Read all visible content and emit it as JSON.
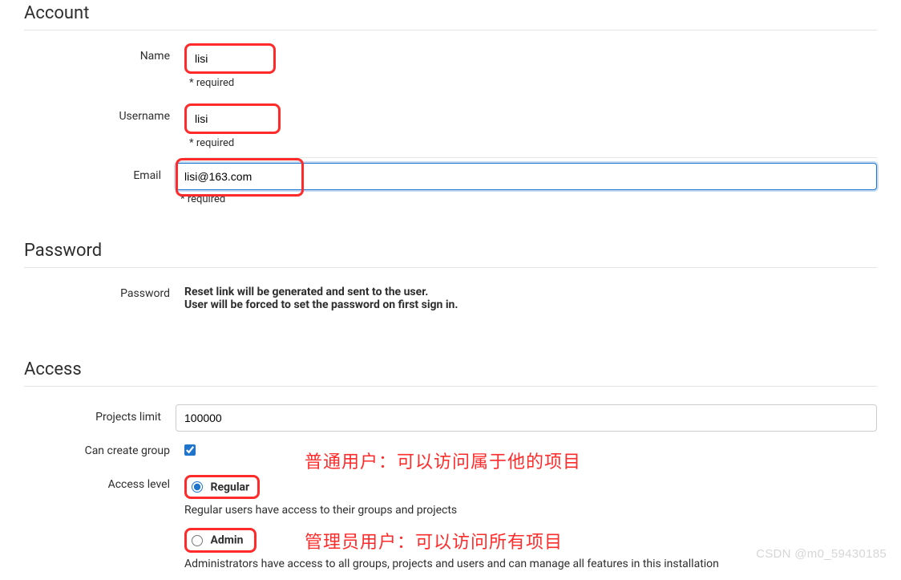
{
  "account": {
    "title": "Account",
    "name_label": "Name",
    "name_value": "lisi",
    "name_help": "* required",
    "username_label": "Username",
    "username_value": "lisi",
    "username_help": "* required",
    "email_label": "Email",
    "email_value": "lisi@163.com",
    "email_help": "* required"
  },
  "password": {
    "title": "Password",
    "label": "Password",
    "line1": "Reset link will be generated and sent to the user.",
    "line2": "User will be forced to set the password on first sign in."
  },
  "access": {
    "title": "Access",
    "projects_limit_label": "Projects limit",
    "projects_limit_value": "100000",
    "can_create_group_label": "Can create group",
    "can_create_group_checked": true,
    "access_level_label": "Access level",
    "regular_label": "Regular",
    "regular_desc": "Regular users have access to their groups and projects",
    "admin_label": "Admin",
    "admin_desc": "Administrators have access to all groups, projects and users and can manage all features in this installation"
  },
  "annotations": {
    "regular_note": "普通用户：可以访问属于他的项目",
    "admin_note": "管理员用户：可以访问所有项目"
  },
  "watermark": "CSDN @m0_59430185"
}
